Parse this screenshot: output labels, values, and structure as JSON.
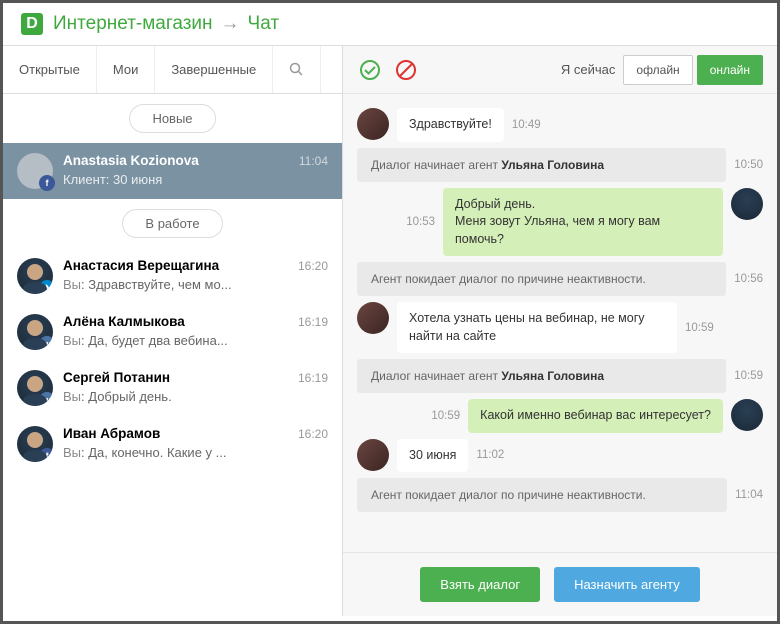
{
  "breadcrumb": {
    "shop": "Интернет-магазин",
    "chat": "Чат"
  },
  "tabs": {
    "open": "Открытые",
    "mine": "Мои",
    "done": "Завершенные"
  },
  "pills": {
    "new": "Новые",
    "working": "В работе"
  },
  "status": {
    "label": "Я сейчас",
    "offline": "офлайн",
    "online": "онлайн"
  },
  "you_prefix": "Вы",
  "selected": {
    "name": "Anastasia Kozionova",
    "time": "11:04",
    "sub": "Клиент: 30 июня"
  },
  "convs": [
    {
      "name": "Анастасия Верещагина",
      "time": "16:20",
      "preview": "Здравствуйте, чем мо...",
      "net": "tg"
    },
    {
      "name": "Алёна Калмыкова",
      "time": "16:19",
      "preview": "Да, будет два вебина...",
      "net": "vk"
    },
    {
      "name": "Сергей Потанин",
      "time": "16:19",
      "preview": "Добрый день.",
      "net": "vk"
    },
    {
      "name": "Иван Абрамов",
      "time": "16:20",
      "preview": "Да, конечно. Какие у ...",
      "net": "fb"
    }
  ],
  "messages": [
    {
      "type": "client",
      "text": "Здравствуйте!",
      "time": "10:49"
    },
    {
      "type": "sys",
      "prefix": "Диалог начинает агент ",
      "bold": "Ульяна Головина",
      "time": "10:50"
    },
    {
      "type": "agent",
      "text": "Добрый день.\nМеня зовут Ульяна, чем я могу вам помочь?",
      "time": "10:53"
    },
    {
      "type": "sys",
      "prefix": "Агент покидает диалог по причине неактивности.",
      "bold": "",
      "time": "10:56"
    },
    {
      "type": "client",
      "text": "Хотела узнать цены на вебинар, не могу найти на сайте",
      "time": "10:59"
    },
    {
      "type": "sys",
      "prefix": "Диалог начинает агент ",
      "bold": "Ульяна Головина",
      "time": "10:59"
    },
    {
      "type": "agent",
      "text": "Какой именно вебинар вас интересует?",
      "time": "10:59"
    },
    {
      "type": "client",
      "text": "30 июня",
      "time": "11:02"
    },
    {
      "type": "sys",
      "prefix": "Агент покидает диалог по причине неактивности.",
      "bold": "",
      "time": "11:04"
    }
  ],
  "footer": {
    "take": "Взять диалог",
    "assign": "Назначить агенту"
  }
}
